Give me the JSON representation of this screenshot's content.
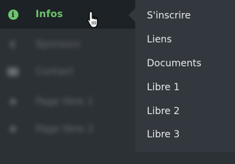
{
  "sidebar": {
    "active_item": {
      "label": "Infos",
      "icon": "info-icon"
    },
    "items": [
      {
        "label": "Sponsors",
        "icon": "back-arrow-icon"
      },
      {
        "label": "Contact",
        "icon": "card-icon"
      },
      {
        "label": "Page libre 1",
        "icon": "pin-icon"
      },
      {
        "label": "Page libre 2",
        "icon": "pin-icon"
      }
    ]
  },
  "submenu": {
    "items": [
      "S'inscrire",
      "Liens",
      "Documents",
      "Libre 1",
      "Libre 2",
      "Libre 3"
    ]
  },
  "colors": {
    "sidebar_bg": "#2c3136",
    "active_bg": "#1d2226",
    "accent": "#6dc56d",
    "submenu_bg": "#32383d",
    "submenu_text": "#e8eaec"
  }
}
